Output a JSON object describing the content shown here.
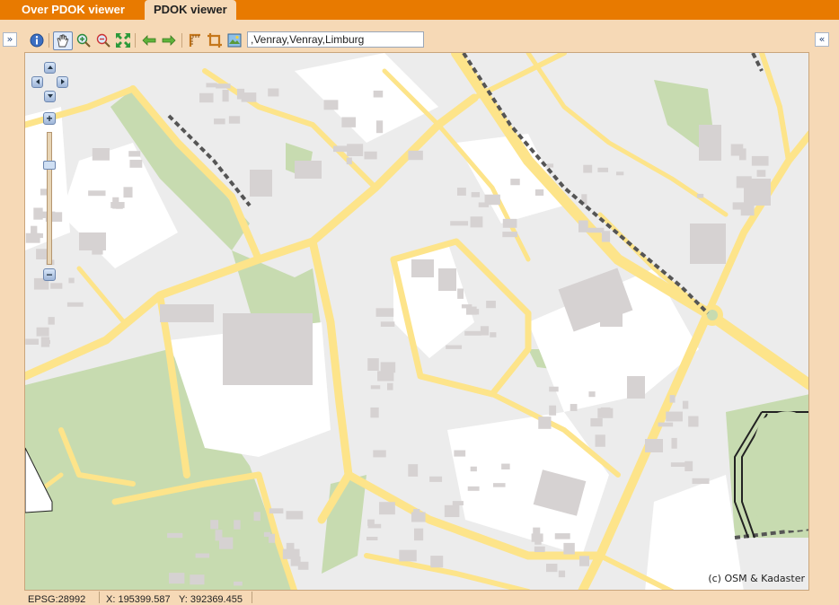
{
  "tabs": [
    {
      "label": "Over PDOK viewer",
      "active": false
    },
    {
      "label": "PDOK viewer",
      "active": true
    }
  ],
  "toolbar": {
    "collapse_left": "»",
    "collapse_right": "«",
    "tools": [
      "info-icon",
      "pan-hand-icon",
      "zoom-in-icon",
      "zoom-out-icon",
      "zoom-extent-icon",
      "back-arrow-icon",
      "forward-arrow-icon",
      "measure-icon",
      "crop-icon",
      "layers-icon"
    ],
    "search_value": ",Venray,Venray,Limburg"
  },
  "map": {
    "attribution": "(c) OSM & Kadaster",
    "zoom_in": "+",
    "zoom_out": "−",
    "colors": {
      "background": "#ececec",
      "road": "#fde48a",
      "building": "#d6d2d2",
      "park": "#c7dbb0",
      "railway": "#555555"
    }
  },
  "status": {
    "projection": "EPSG:28992",
    "x": "X: 195399.587",
    "y": "Y: 392369.455"
  }
}
